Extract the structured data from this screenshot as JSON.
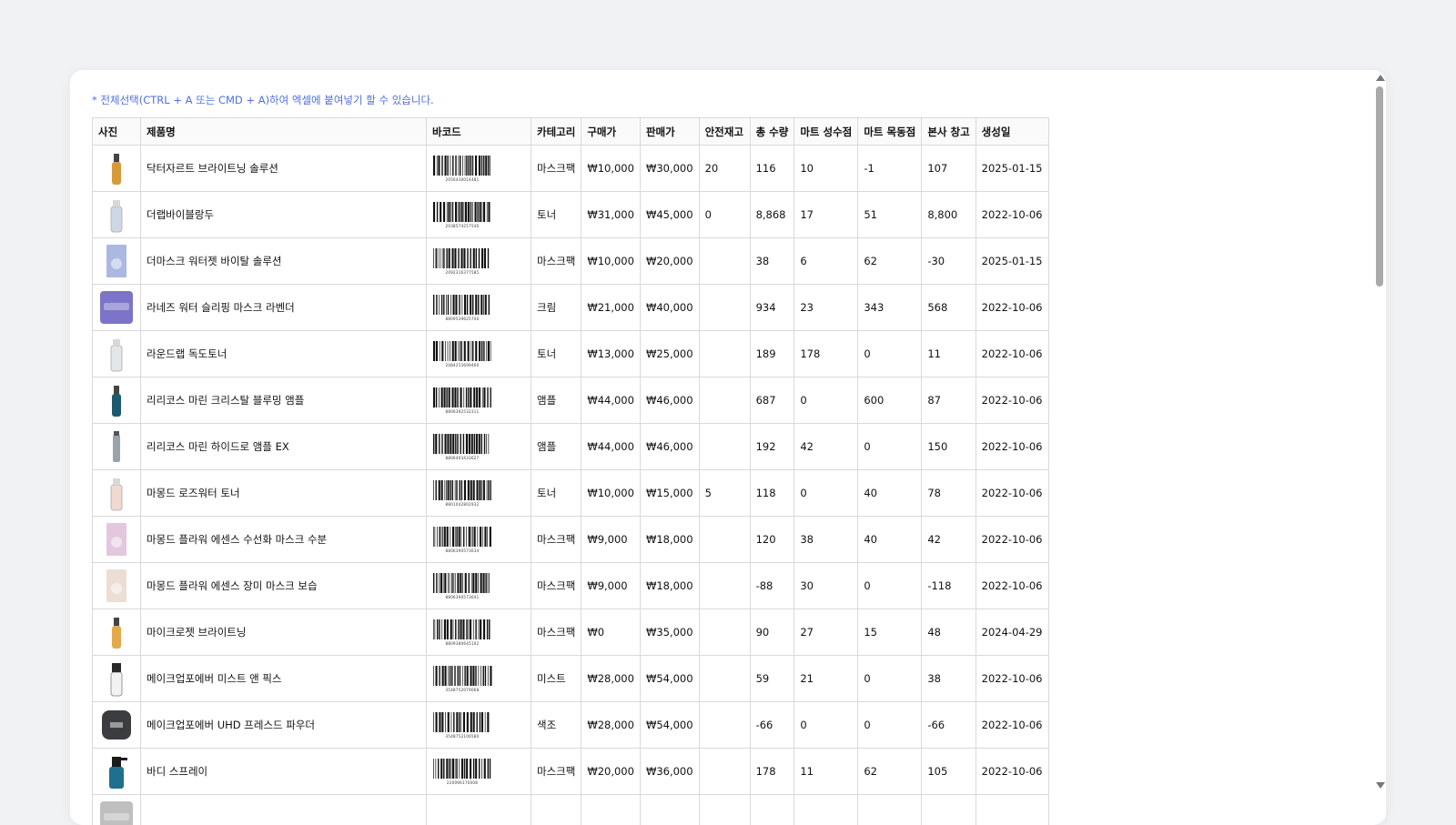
{
  "hint_text": "* 전체선택(CTRL + A 또는 CMD + A)하여 엑셀에 붙여넣기 할 수 있습니다.",
  "columns": [
    "사진",
    "제품명",
    "바코드",
    "카테고리",
    "구매가",
    "판매가",
    "안전재고",
    "총 수량",
    "마트 성수점",
    "마트 목동점",
    "본사 창고",
    "생성일"
  ],
  "rows": [
    {
      "photo": "ampoule-bottle",
      "photo_color": "#d79a3a",
      "name": "닥터자르트 브라이트닝 솔루션",
      "barcode": "2056430014481",
      "category": "마스크팩",
      "cost": "₩10,000",
      "price": "₩30,000",
      "safety": "20",
      "total": "116",
      "seongsu": "10",
      "mokdong": "-1",
      "warehouse": "107",
      "created": "2025-01-15"
    },
    {
      "photo": "toner-bottle",
      "photo_color": "#cfd6e4",
      "name": "더랩바이블랑두",
      "barcode": "2038574257540",
      "category": "토너",
      "cost": "₩31,000",
      "price": "₩45,000",
      "safety": "0",
      "total": "8,868",
      "seongsu": "17",
      "mokdong": "51",
      "warehouse": "8,800",
      "created": "2022-10-06"
    },
    {
      "photo": "mask-pack",
      "photo_color": "#8fa0d8",
      "name": "더마스크 워터젯 바이탈 솔루션",
      "barcode": "2092316377585",
      "category": "마스크팩",
      "cost": "₩10,000",
      "price": "₩20,000",
      "safety": "",
      "total": "38",
      "seongsu": "6",
      "mokdong": "62",
      "warehouse": "-30",
      "created": "2025-01-15"
    },
    {
      "photo": "cream-jar",
      "photo_color": "#7c74c8",
      "name": "라네즈 워터 슬리핑 마스크 라벤더",
      "barcode": "8809539625740",
      "category": "크림",
      "cost": "₩21,000",
      "price": "₩40,000",
      "safety": "",
      "total": "934",
      "seongsu": "23",
      "mokdong": "343",
      "warehouse": "568",
      "created": "2022-10-06"
    },
    {
      "photo": "toner-bottle",
      "photo_color": "#e3e7ea",
      "name": "라운드랩 독도토너",
      "barcode": "2084253699460",
      "category": "토너",
      "cost": "₩13,000",
      "price": "₩25,000",
      "safety": "",
      "total": "189",
      "seongsu": "178",
      "mokdong": "0",
      "warehouse": "11",
      "created": "2022-10-06"
    },
    {
      "photo": "ampoule-bottle",
      "photo_color": "#1d5a6e",
      "name": "리리코스 마린 크리스탈 블루밍 앰플",
      "barcode": "8806392532311",
      "category": "앰플",
      "cost": "₩44,000",
      "price": "₩46,000",
      "safety": "",
      "total": "687",
      "seongsu": "0",
      "mokdong": "600",
      "warehouse": "87",
      "created": "2022-10-06"
    },
    {
      "photo": "slim-tube",
      "photo_color": "#9aa3ac",
      "name": "리리코스 마린 하이드로 앰플 EX",
      "barcode": "8806403433627",
      "category": "앰플",
      "cost": "₩44,000",
      "price": "₩46,000",
      "safety": "",
      "total": "192",
      "seongsu": "42",
      "mokdong": "0",
      "warehouse": "150",
      "created": "2022-10-06"
    },
    {
      "photo": "toner-bottle",
      "photo_color": "#f0d9cf",
      "name": "마몽드 로즈워터 토너",
      "barcode": "8801042802932",
      "category": "토너",
      "cost": "₩10,000",
      "price": "₩15,000",
      "safety": "5",
      "total": "118",
      "seongsu": "0",
      "mokdong": "40",
      "warehouse": "78",
      "created": "2022-10-06"
    },
    {
      "photo": "mask-pack",
      "photo_color": "#d8b4d4",
      "name": "마몽드 플라워 에센스 수선화 마스크 수분",
      "barcode": "8806390573634",
      "category": "마스크팩",
      "cost": "₩9,000",
      "price": "₩18,000",
      "safety": "",
      "total": "120",
      "seongsu": "38",
      "mokdong": "40",
      "warehouse": "42",
      "created": "2022-10-06"
    },
    {
      "photo": "mask-pack",
      "photo_color": "#e6d3c4",
      "name": "마몽드 플라워 에센스 장미 마스크 보습",
      "barcode": "8806390573641",
      "category": "마스크팩",
      "cost": "₩9,000",
      "price": "₩18,000",
      "safety": "",
      "total": "-88",
      "seongsu": "30",
      "mokdong": "0",
      "warehouse": "-118",
      "created": "2022-10-06"
    },
    {
      "photo": "ampoule-bottle",
      "photo_color": "#e3a94a",
      "name": "마이크로젯 브라이트닝",
      "barcode": "8809380645102",
      "category": "마스크팩",
      "cost": "₩0",
      "price": "₩35,000",
      "safety": "",
      "total": "90",
      "seongsu": "27",
      "mokdong": "15",
      "warehouse": "48",
      "created": "2024-04-29"
    },
    {
      "photo": "mist-bottle",
      "photo_color": "#2a2a2a",
      "name": "메이크업포에버 미스트 앤 픽스",
      "barcode": "3548752079068",
      "category": "미스트",
      "cost": "₩28,000",
      "price": "₩54,000",
      "safety": "",
      "total": "59",
      "seongsu": "21",
      "mokdong": "0",
      "warehouse": "38",
      "created": "2022-10-06"
    },
    {
      "photo": "compact",
      "photo_color": "#3b3d41",
      "name": "메이크업포에버 UHD 프레스드 파우더",
      "barcode": "3548752106580",
      "category": "색조",
      "cost": "₩28,000",
      "price": "₩54,000",
      "safety": "",
      "total": "-66",
      "seongsu": "0",
      "mokdong": "0",
      "warehouse": "-66",
      "created": "2022-10-06"
    },
    {
      "photo": "spray-bottle",
      "photo_color": "#1f6f8f",
      "name": "바디 스프레이",
      "barcode": "220096170008",
      "category": "마스크팩",
      "cost": "₩20,000",
      "price": "₩36,000",
      "safety": "",
      "total": "178",
      "seongsu": "11",
      "mokdong": "62",
      "warehouse": "105",
      "created": "2022-10-06"
    },
    {
      "photo": "cream-jar",
      "photo_color": "#bfbfbf",
      "name": "",
      "barcode": "",
      "category": "",
      "cost": "",
      "price": "",
      "safety": "",
      "total": "",
      "seongsu": "",
      "mokdong": "",
      "warehouse": "",
      "created": ""
    }
  ]
}
